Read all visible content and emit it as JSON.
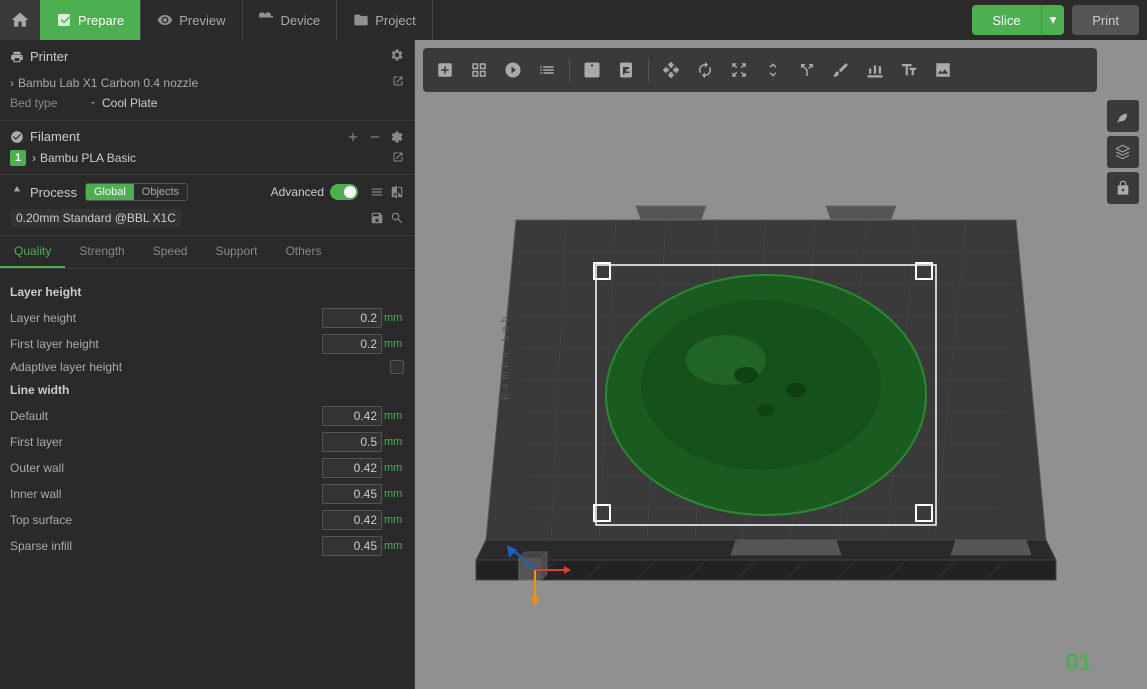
{
  "topbar": {
    "tabs": [
      {
        "id": "prepare",
        "label": "Prepare",
        "active": true
      },
      {
        "id": "preview",
        "label": "Preview",
        "active": false
      },
      {
        "id": "device",
        "label": "Device",
        "active": false
      },
      {
        "id": "project",
        "label": "Project",
        "active": false
      }
    ],
    "slice_label": "Slice",
    "print_label": "Print"
  },
  "printer": {
    "section_label": "Printer",
    "name": "Bambu Lab X1 Carbon 0.4 nozzle",
    "bed_type_label": "Bed type",
    "bed_type_value": "Cool Plate"
  },
  "filament": {
    "section_label": "Filament",
    "items": [
      {
        "num": "1",
        "name": "Bambu PLA Basic"
      }
    ]
  },
  "process": {
    "section_label": "Process",
    "toggle_global": "Global",
    "toggle_objects": "Objects",
    "advanced_label": "Advanced",
    "preset_name": "0.20mm Standard @BBL X1C"
  },
  "quality": {
    "tabs": [
      {
        "id": "quality",
        "label": "Quality",
        "active": true
      },
      {
        "id": "strength",
        "label": "Strength",
        "active": false
      },
      {
        "id": "speed",
        "label": "Speed",
        "active": false
      },
      {
        "id": "support",
        "label": "Support",
        "active": false
      },
      {
        "id": "others",
        "label": "Others",
        "active": false
      }
    ],
    "layer_height": {
      "group_label": "Layer height",
      "rows": [
        {
          "name": "Layer height",
          "value": "0.2",
          "unit": "mm",
          "type": "input"
        },
        {
          "name": "First layer height",
          "value": "0.2",
          "unit": "mm",
          "type": "input"
        },
        {
          "name": "Adaptive layer height",
          "value": "",
          "unit": "",
          "type": "checkbox"
        }
      ]
    },
    "line_width": {
      "group_label": "Line width",
      "rows": [
        {
          "name": "Default",
          "value": "0.42",
          "unit": "mm",
          "type": "input"
        },
        {
          "name": "First layer",
          "value": "0.5",
          "unit": "mm",
          "type": "input"
        },
        {
          "name": "Outer wall",
          "value": "0.42",
          "unit": "mm",
          "type": "input"
        },
        {
          "name": "Inner wall",
          "value": "0.45",
          "unit": "mm",
          "type": "input"
        },
        {
          "name": "Top surface",
          "value": "0.42",
          "unit": "mm",
          "type": "input"
        },
        {
          "name": "Sparse infill",
          "value": "0.45",
          "unit": "mm",
          "type": "input"
        }
      ]
    }
  },
  "viewport": {
    "num_badge": "01"
  }
}
